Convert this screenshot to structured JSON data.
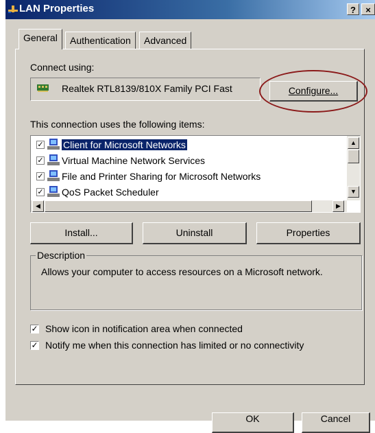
{
  "window": {
    "title": "LAN Properties",
    "help_btn": "?",
    "close_btn": "×"
  },
  "tabs": [
    "General",
    "Authentication",
    "Advanced"
  ],
  "general": {
    "connect_using_label": "Connect using:",
    "adapter_name": "Realtek RTL8139/810X Family PCI Fast",
    "configure_label": "Configure...",
    "items_label": "This connection uses the following items:",
    "items": [
      {
        "label": "Client for Microsoft Networks",
        "checked": true,
        "selected": true
      },
      {
        "label": "Virtual Machine Network Services",
        "checked": true,
        "selected": false
      },
      {
        "label": "File and Printer Sharing for Microsoft Networks",
        "checked": true,
        "selected": false
      },
      {
        "label": "QoS Packet Scheduler",
        "checked": true,
        "selected": false
      }
    ],
    "install_label": "Install...",
    "uninstall_label": "Uninstall",
    "properties_label": "Properties",
    "description_legend": "Description",
    "description_text": "Allows your computer to access resources on a Microsoft network.",
    "show_icon_label": "Show icon in notification area when connected",
    "notify_label": "Notify me when this connection has limited or no connectivity",
    "show_icon_checked": true,
    "notify_checked": true
  },
  "footer": {
    "ok_label": "OK",
    "cancel_label": "Cancel"
  },
  "colors": {
    "title_bar": "#0a246a",
    "dialog_face": "#d4d0c8",
    "selection": "#0a246a",
    "annotation_ellipse": "#8b1a1a"
  }
}
